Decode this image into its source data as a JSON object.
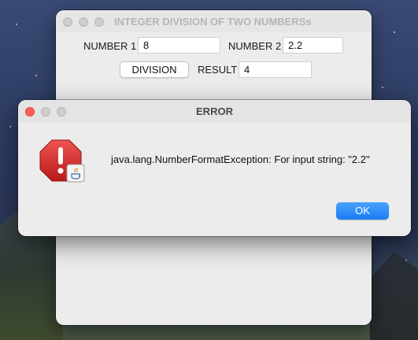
{
  "main_window": {
    "title": "INTEGER DIVISION OF TWO NUMBERSs",
    "number1_label": "NUMBER 1",
    "number1_value": "8",
    "number2_label": "NUMBER 2",
    "number2_value": "2.2",
    "division_button": "DIVISION",
    "result_label": "RESULT",
    "result_value": "4"
  },
  "error_dialog": {
    "title": "ERROR",
    "message": "java.lang.NumberFormatException: For input string: \"2.2\"",
    "ok_button": "OK",
    "icon": "error-stop-icon",
    "accent_color": "#1a7df5",
    "error_color": "#d32f2f"
  }
}
